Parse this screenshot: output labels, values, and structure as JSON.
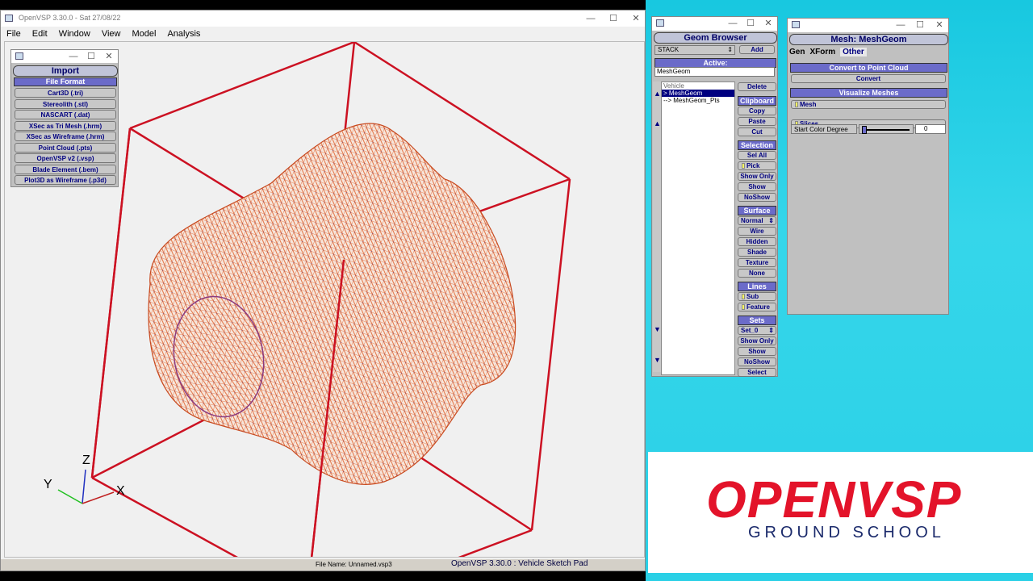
{
  "main": {
    "title": "OpenVSP 3.30.0 - Sat 27/08/22",
    "menu": [
      "File",
      "Edit",
      "Window",
      "View",
      "Model",
      "Analysis"
    ],
    "axes": {
      "z": "Z",
      "y": "Y",
      "x": "X"
    },
    "status_file": "File Name: Unnamed.vsp3",
    "status_app": "OpenVSP 3.30.0 : Vehicle Sketch Pad"
  },
  "import": {
    "title": "Import",
    "header": "File Format",
    "buttons": [
      "Cart3D (.tri)",
      "Stereolith (.stl)",
      "NASCART (.dat)",
      "XSec as Tri Mesh (.hrm)",
      "XSec as Wireframe (.hrm)",
      "Point Cloud (.pts)",
      "OpenVSP v2 (.vsp)",
      "Blade Element (.bem)",
      "Plot3D as Wireframe (.p3d)"
    ]
  },
  "geom_browser": {
    "title": "Geom Browser",
    "stack": "STACK",
    "add": "Add",
    "active_label": "Active:",
    "active_value": "MeshGeom",
    "tree": [
      "Vehicle",
      "> MeshGeom",
      "--> MeshGeom_Pts"
    ],
    "delete": "Delete",
    "clipboard": "Clipboard",
    "clip_buttons": [
      "Copy",
      "Paste",
      "Cut"
    ],
    "selection": "Selection",
    "sel_all": "Sel All",
    "pick": "Pick",
    "sel_buttons": [
      "Show Only",
      "Show",
      "NoShow"
    ],
    "surface": "Surface",
    "surface_mode": "Normal",
    "surface_buttons": [
      "Wire",
      "Hidden",
      "Shade",
      "Texture",
      "None"
    ],
    "lines": "Lines",
    "line_toggles": [
      "Sub",
      "Feature"
    ],
    "sets": "Sets",
    "set_value": "Set_0",
    "set_buttons": [
      "Show Only",
      "Show",
      "NoShow",
      "Select"
    ]
  },
  "mesh_geom": {
    "title": "Mesh: MeshGeom",
    "tabs": [
      "Gen",
      "XForm",
      "Other"
    ],
    "convert_header": "Convert to Point Cloud",
    "convert_btn": "Convert",
    "visualize_header": "Visualize Meshes",
    "toggles": [
      "Mesh",
      "Slices"
    ],
    "color_label": "Start Color Degree",
    "color_value": "0"
  },
  "logo": {
    "main": "OPENVSP",
    "sub": "GROUND SCHOOL"
  },
  "colors": {
    "accent": "#6b6bc9",
    "box": "#cc1122",
    "logo_red": "#e3132a",
    "logo_blue": "#1b2a6b"
  }
}
